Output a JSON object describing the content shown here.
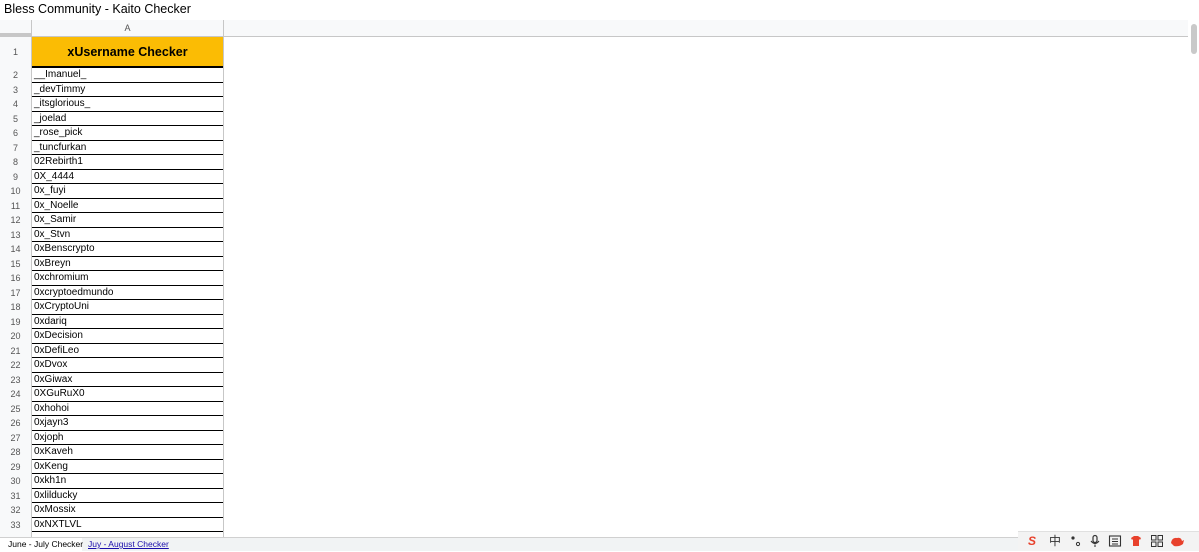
{
  "window": {
    "title": "Bless Community - Kaito Checker"
  },
  "column_header": "A",
  "header_row": {
    "number": "1",
    "text": "xUsername Checker"
  },
  "rows": [
    {
      "n": "2",
      "v": "__Imanuel_"
    },
    {
      "n": "3",
      "v": "_devTimmy"
    },
    {
      "n": "4",
      "v": "_itsglorious_"
    },
    {
      "n": "5",
      "v": "_joelad"
    },
    {
      "n": "6",
      "v": "_rose_pick"
    },
    {
      "n": "7",
      "v": "_tuncfurkan"
    },
    {
      "n": "8",
      "v": "02Rebirth1"
    },
    {
      "n": "9",
      "v": "0X_4444"
    },
    {
      "n": "10",
      "v": "0x_fuyi"
    },
    {
      "n": "11",
      "v": "0x_Noelle"
    },
    {
      "n": "12",
      "v": "0x_Samir"
    },
    {
      "n": "13",
      "v": "0x_Stvn"
    },
    {
      "n": "14",
      "v": "0xBenscrypto"
    },
    {
      "n": "15",
      "v": "0xBreyn"
    },
    {
      "n": "16",
      "v": "0xchromium"
    },
    {
      "n": "17",
      "v": "0xcryptoedmundo"
    },
    {
      "n": "18",
      "v": "0xCryptoUni"
    },
    {
      "n": "19",
      "v": "0xdariq"
    },
    {
      "n": "20",
      "v": "0xDecision"
    },
    {
      "n": "21",
      "v": "0xDefiLeo"
    },
    {
      "n": "22",
      "v": "0xDvox"
    },
    {
      "n": "23",
      "v": "0xGiwax"
    },
    {
      "n": "24",
      "v": "0XGuRuX0"
    },
    {
      "n": "25",
      "v": "0xhohoi"
    },
    {
      "n": "26",
      "v": "0xjayn3"
    },
    {
      "n": "27",
      "v": "0xjoph"
    },
    {
      "n": "28",
      "v": "0xKaveh"
    },
    {
      "n": "29",
      "v": "0xKeng"
    },
    {
      "n": "30",
      "v": "0xkh1n"
    },
    {
      "n": "31",
      "v": "0xlilducky"
    },
    {
      "n": "32",
      "v": "0xMossix"
    },
    {
      "n": "33",
      "v": "0xNXTLVL"
    }
  ],
  "tabs": [
    {
      "label": "June - July Checker",
      "active": true
    },
    {
      "label": "Juy - August Checker",
      "active": false
    }
  ],
  "tray": {
    "icons": [
      "sogou-s-icon",
      "chinese-mode-icon",
      "punctuation-icon",
      "microphone-icon",
      "keyboard-icon",
      "skin-icon",
      "grid-icon",
      "toolbox-icon"
    ],
    "mode_label": "中",
    "s_label": "S"
  },
  "colors": {
    "header_fill": "#fbbc04",
    "link": "#1a0dab"
  }
}
